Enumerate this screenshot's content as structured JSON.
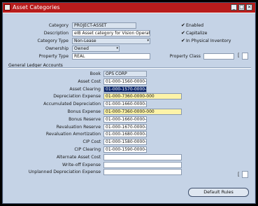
{
  "window": {
    "title": "Asset Categories",
    "minimize": "_",
    "maximize": "□",
    "close": "×"
  },
  "header": {
    "category_label": "Category",
    "category_value": "PROJECT-ASSET",
    "description_label": "Description",
    "description_value": "eIB Asset category for Vision Operations",
    "category_type_label": "Category Type",
    "category_type_value": "Non-Lease",
    "ownership_label": "Ownership",
    "ownership_value": "Owned",
    "property_type_label": "Property Type",
    "property_type_value": "REAL",
    "property_class_label": "Property Class",
    "property_class_value": "",
    "enabled_label": "Enabled",
    "capitalize_label": "Capitalize",
    "physical_inventory_label": "In Physical Inventory",
    "check_mark": "✔"
  },
  "gl": {
    "section_title": "General Ledger Accounts",
    "rows": [
      {
        "label": "Book",
        "value": "OPS CORP"
      },
      {
        "label": "Asset Cost",
        "value": "01-000-1560-0000-000"
      },
      {
        "label": "Asset Clearing",
        "value": "01-000-1570-0000-000"
      },
      {
        "label": "Depreciation Expense",
        "value": "01-000-7360-0000-000"
      },
      {
        "label": "Accumulated Depreciation",
        "value": "01-000-1660-0000-000"
      },
      {
        "label": "Bonus Expense",
        "value": "01-000-7360-0000-000"
      },
      {
        "label": "Bonus Reserve",
        "value": "01-000-1660-0000-000"
      },
      {
        "label": "Revaluation Reserve",
        "value": "01-000-1670-0000-000"
      },
      {
        "label": "Revaluation Amortization",
        "value": "01-000-1680-0000-000"
      },
      {
        "label": "CIP Cost",
        "value": "01-000-1580-0000-000"
      },
      {
        "label": "CIP Clearing",
        "value": "01-000-1590-0000-000"
      },
      {
        "label": "Alternate Asset Cost",
        "value": ""
      },
      {
        "label": "Write-off Expense",
        "value": ""
      },
      {
        "label": "Unplanned Depreciation Expense",
        "value": ""
      }
    ]
  },
  "buttons": {
    "default_rules": "Default Rules"
  },
  "dropdown_glyph": "▾"
}
